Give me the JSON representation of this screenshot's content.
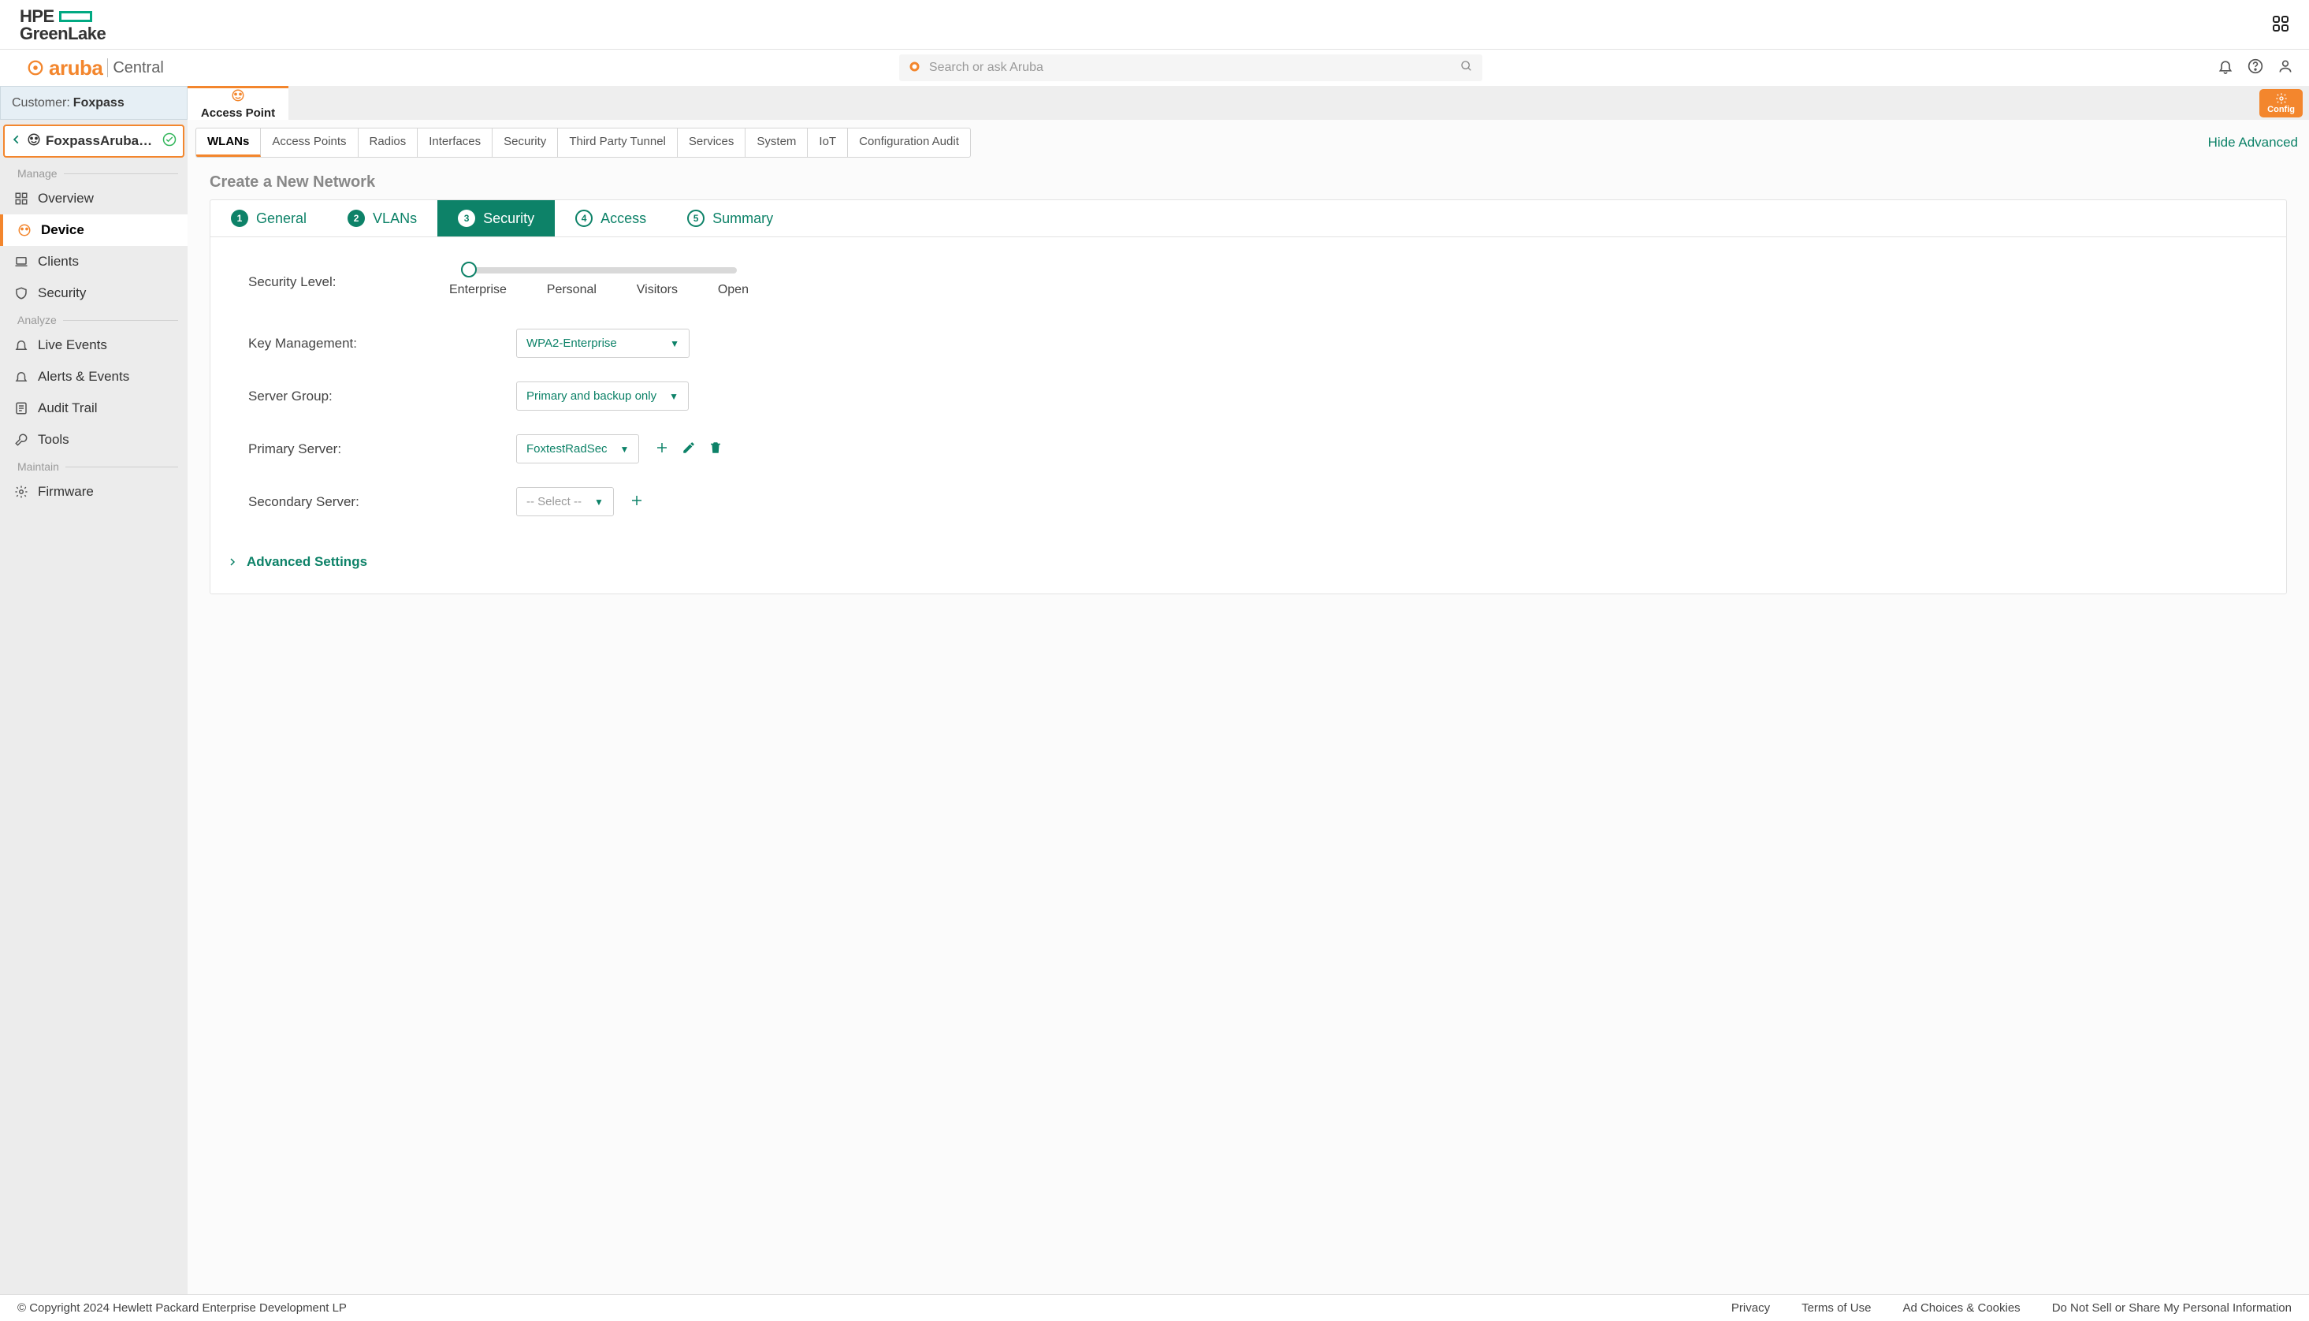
{
  "brand": {
    "hpe_top": "HPE",
    "hpe_bottom": "GreenLake",
    "aruba": "aruba",
    "central": "Central"
  },
  "search": {
    "placeholder": "Search or ask Aruba"
  },
  "customer": {
    "label": "Customer: ",
    "name": "Foxpass"
  },
  "ap_tab": {
    "label": "Access Point"
  },
  "config_btn": {
    "label": "Config"
  },
  "device_selector": {
    "name": "FoxpassArubaAP..."
  },
  "sidebar": {
    "groups": {
      "manage": "Manage",
      "analyze": "Analyze",
      "maintain": "Maintain"
    },
    "items": {
      "overview": "Overview",
      "device": "Device",
      "clients": "Clients",
      "security": "Security",
      "live_events": "Live Events",
      "alerts": "Alerts & Events",
      "audit": "Audit Trail",
      "tools": "Tools",
      "firmware": "Firmware"
    }
  },
  "subtabs": {
    "wlans": "WLANs",
    "aps": "Access Points",
    "radios": "Radios",
    "interfaces": "Interfaces",
    "security": "Security",
    "tpt": "Third Party Tunnel",
    "services": "Services",
    "system": "System",
    "iot": "IoT",
    "config_audit": "Configuration Audit"
  },
  "hide_adv": "Hide Advanced",
  "page_title": "Create a New Network",
  "stepper": {
    "s1": "General",
    "s2": "VLANs",
    "s3": "Security",
    "s4": "Access",
    "s5": "Summary"
  },
  "form": {
    "sec_level_label": "Security Level:",
    "sec_levels": {
      "ent": "Enterprise",
      "pers": "Personal",
      "vis": "Visitors",
      "open": "Open"
    },
    "key_mgmt_label": "Key Management:",
    "key_mgmt_value": "WPA2-Enterprise",
    "server_group_label": "Server Group:",
    "server_group_value": "Primary and backup only",
    "primary_label": "Primary Server:",
    "primary_value": "FoxtestRadSec",
    "secondary_label": "Secondary Server:",
    "secondary_value": "-- Select --",
    "adv_settings": "Advanced Settings"
  },
  "footer": {
    "copyright": "© Copyright 2024 Hewlett Packard Enterprise Development LP",
    "privacy": "Privacy",
    "terms": "Terms of Use",
    "adchoices": "Ad Choices & Cookies",
    "donotsell": "Do Not Sell or Share My Personal Information"
  }
}
